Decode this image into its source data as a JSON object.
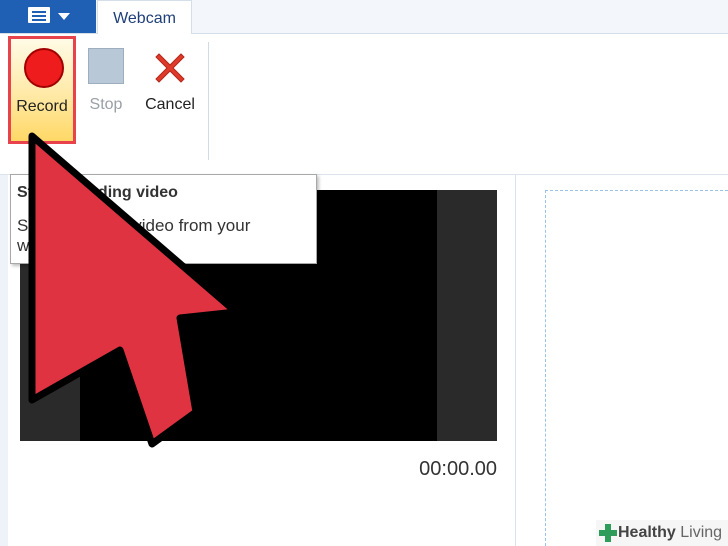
{
  "tabs": [
    {
      "label": "Webcam"
    }
  ],
  "ribbon": {
    "record_label": "Record",
    "stop_label": "Stop",
    "cancel_label": "Cancel"
  },
  "tooltip": {
    "title": "Start recording video",
    "description": "Start recording video from your webcam."
  },
  "video": {
    "timer": "00:00.00"
  },
  "watermark": {
    "part1": "Healthy",
    "part2": "Living"
  },
  "colors": {
    "app_menu": "#1f5fb4",
    "record_highlight": "#e8424c",
    "record_dot": "#ee1c1c",
    "arrow": "#e03342",
    "cancel_x": "#e03a2a"
  },
  "icons": [
    "app-menu-icon",
    "record-icon",
    "stop-icon",
    "cancel-x-icon",
    "pointer-arrow-icon",
    "cross-logo-icon"
  ]
}
